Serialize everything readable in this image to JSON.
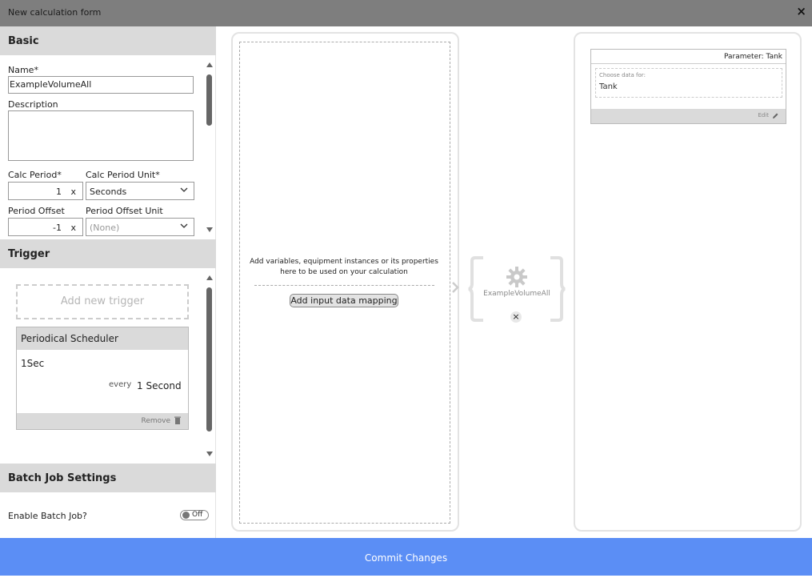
{
  "window": {
    "title": "New calculation form",
    "close_icon": "×"
  },
  "basic": {
    "header": "Basic",
    "name_label": "Name*",
    "name_value": "ExampleVolumeAll",
    "description_label": "Description",
    "calc_period_label": "Calc Period*",
    "calc_period_value": "1",
    "calc_period_clear": "x",
    "calc_period_unit_label": "Calc Period Unit*",
    "calc_period_unit_value": "Seconds",
    "period_offset_label": "Period Offset",
    "period_offset_value": "-1",
    "period_offset_clear": "x",
    "period_offset_unit_label": "Period Offset Unit",
    "period_offset_unit_value": "(None)"
  },
  "trigger": {
    "header": "Trigger",
    "add_label": "Add new trigger",
    "card": {
      "title": "Periodical Scheduler",
      "name": "1Sec",
      "every_label": "every",
      "period": "1 Second",
      "remove_label": "Remove"
    }
  },
  "batch": {
    "header": "Batch Job Settings",
    "enable_label": "Enable Batch Job?",
    "toggle_label": "Off"
  },
  "inputs": {
    "hint": "Add variables, equipment instances or its properties here to be used on your calculation",
    "add_mapping_label": "Add input data mapping"
  },
  "calculation": {
    "name": "ExampleVolumeAll",
    "remove_icon": "×"
  },
  "output": {
    "param_header": "Parameter: Tank",
    "choose_label": "Choose data for:",
    "choose_value": "Tank",
    "edit_label": "Edit"
  },
  "commit_label": "Commit Changes",
  "colors": {
    "accent": "#5b8ef5",
    "titlebar": "#7e7e7e",
    "section": "#dadada"
  }
}
